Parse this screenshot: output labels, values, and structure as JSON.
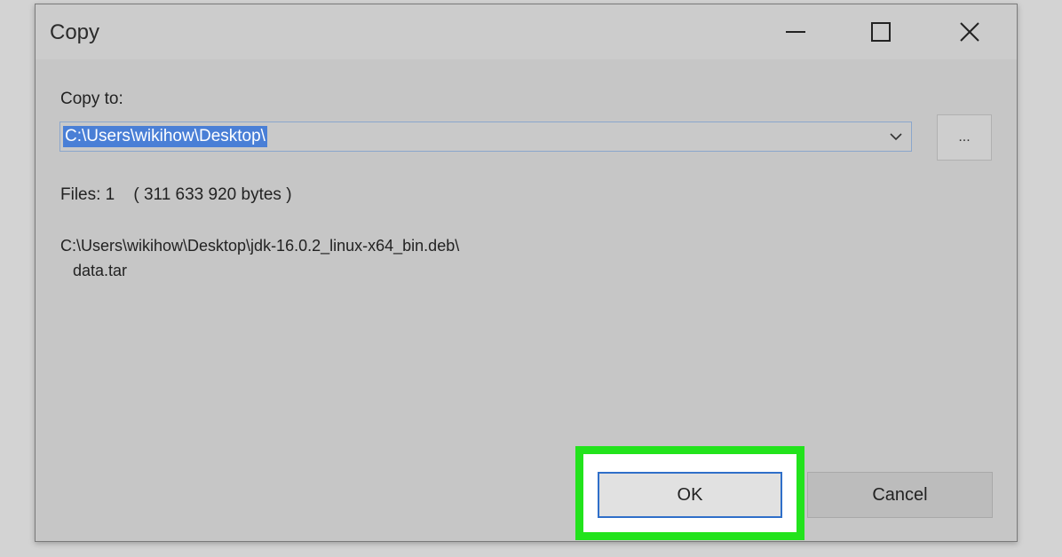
{
  "window": {
    "title": "Copy",
    "controls": [
      "minimize",
      "maximize",
      "close"
    ]
  },
  "form": {
    "copy_to_label": "Copy to:",
    "destination_path": "C:\\Users\\wikihow\\Desktop\\",
    "browse_label": "...",
    "files_label": "Files: 1",
    "bytes_label": "( 311 633 920 bytes )",
    "source_path_line1": "C:\\Users\\wikihow\\Desktop\\jdk-16.0.2_linux-x64_bin.deb\\",
    "source_path_line2": "data.tar"
  },
  "buttons": {
    "ok_label": "OK",
    "cancel_label": "Cancel"
  },
  "icons": {
    "minimize": "minimize-icon",
    "maximize": "maximize-icon",
    "close": "close-icon",
    "dropdown": "chevron-down-icon"
  },
  "colors": {
    "selection": "#4a7fd6",
    "highlight_box": "#22e31c",
    "ok_border": "#2f6fc9"
  }
}
